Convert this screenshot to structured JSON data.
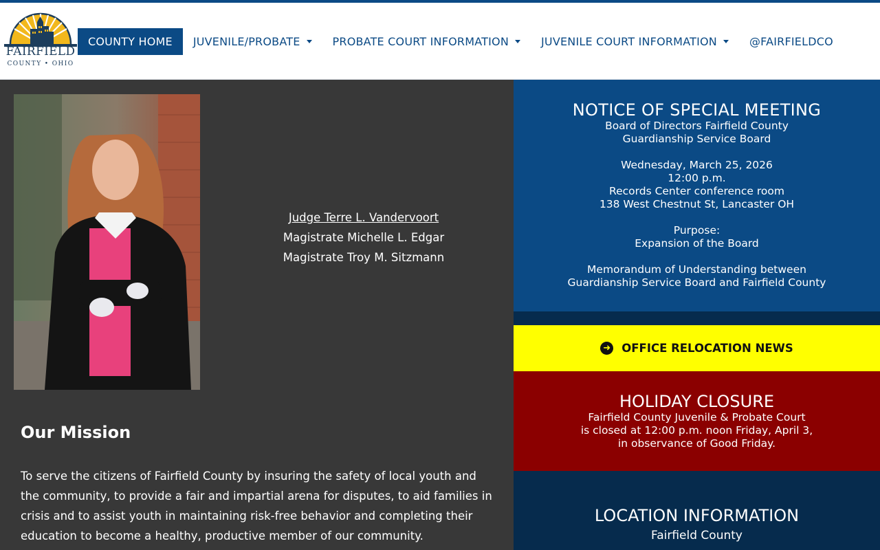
{
  "logo": {
    "wordmark": "FAIRFIELD",
    "subline": "COUNTY • OHIO",
    "colors": {
      "sun": "#f2b81c",
      "ink": "#1c3d5c"
    }
  },
  "nav": {
    "items": [
      {
        "label": "COUNTY HOME",
        "active": true,
        "dropdown": false
      },
      {
        "label": "JUVENILE/PROBATE",
        "active": false,
        "dropdown": true
      },
      {
        "label": "PROBATE COURT INFORMATION",
        "active": false,
        "dropdown": true
      },
      {
        "label": "JUVENILE COURT INFORMATION",
        "active": false,
        "dropdown": true
      },
      {
        "label": "@FAIRFIELDCO",
        "active": false,
        "dropdown": false
      }
    ]
  },
  "officials": {
    "judge": "Judge Terre L. Vandervoort",
    "magistrate1": "Magistrate Michelle L. Edgar",
    "magistrate2": "Magistrate Troy M. Sitzmann"
  },
  "mission": {
    "title": "Our Mission",
    "text": "To serve the citizens of Fairfield County by insuring the safety of local youth and the community, to provide a fair and impartial arena for disputes, to aid families in crisis and to assist youth in maintaining risk-free behavior and completing their education to become a healthy, productive member of our community."
  },
  "notice": {
    "title": "NOTICE OF SPECIAL MEETING",
    "line1": "Board of Directors Fairfield County",
    "line2": "Guardianship Service Board",
    "date": "Wednesday, March 25, 2026",
    "time": "12:00 p.m.",
    "place": "Records Center conference room",
    "address": "138 West Chestnut St, Lancaster OH",
    "purpose_label": "Purpose:",
    "purpose": "Expansion of the Board",
    "memo1": "Memorandum of Understanding between",
    "memo2": "Guardianship Service Board and Fairfield County"
  },
  "relocation": {
    "label": "OFFICE RELOCATION NEWS",
    "icon": "arrow-circle-right-icon"
  },
  "holiday": {
    "title": "HOLIDAY CLOSURE",
    "line1": "Fairfield County Juvenile & Probate Court",
    "line2": "is closed at 12:00 p.m. noon Friday, April 3,",
    "line3": "in observance of Good Friday."
  },
  "location": {
    "title": "LOCATION INFORMATION",
    "subtitle": "Fairfield County"
  },
  "colors": {
    "brand_blue": "#0b4a85",
    "dark_navy": "#062b4d",
    "panel_gray": "#383838",
    "alert_yellow": "#ffff00",
    "alert_red": "#8b0000"
  }
}
